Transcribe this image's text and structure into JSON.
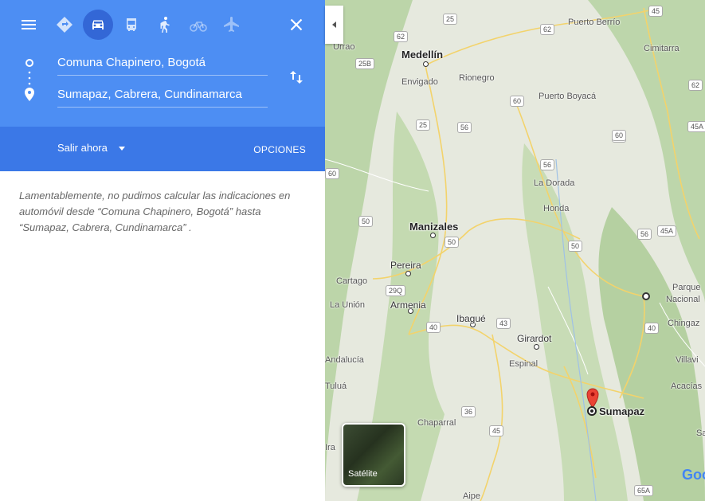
{
  "directions": {
    "origin": "Comuna Chapinero, Bogotá",
    "destination": "Sumapaz, Cabrera, Cundinamarca",
    "depart_label": "Salir ahora",
    "options_label": "OPCIONES",
    "error_message": "Lamentablemente, no pudimos calcular las indicaciones en automóvil desde “Comuna Chapinero, Bogotá” hasta “Sumapaz, Cabrera, Cundinamarca” ."
  },
  "travel_modes": [
    {
      "icon": "best-route-icon",
      "active": false
    },
    {
      "icon": "car-icon",
      "active": true
    },
    {
      "icon": "transit-icon",
      "active": false
    },
    {
      "icon": "walk-icon",
      "active": false
    },
    {
      "icon": "bicycle-icon",
      "active": false
    },
    {
      "icon": "flight-icon",
      "active": false
    }
  ],
  "map": {
    "cities": [
      "Medellín",
      "Manizales",
      "Pereira",
      "Armenia",
      "Ibagué",
      "Girardot",
      "Sumapaz"
    ],
    "towns": [
      "Urrao",
      "Envigado",
      "Rionegro",
      "Puerto Berrío",
      "Cimitarra",
      "Puerto Boyacá",
      "La Dorada",
      "Honda",
      "Cartago",
      "La Unión",
      "Espinal",
      "Chaparral",
      "Tuluá",
      "Andalucía",
      "Aipe",
      "Parque",
      "Nacional",
      "Chingaz",
      "Villavi",
      "Acacías",
      "Ira",
      "Sa"
    ],
    "road_shields": [
      "25",
      "62",
      "25B",
      "45",
      "62",
      "60",
      "25",
      "56",
      "60",
      "56",
      "60",
      "45A",
      "50",
      "50",
      "50",
      "29Q",
      "40",
      "43",
      "40",
      "56",
      "45A",
      "36",
      "45",
      "65A",
      "60",
      "62"
    ],
    "satellite_label": "Satélite",
    "attribution": "Goo"
  },
  "colors": {
    "header_bg": "#4d8ef3",
    "options_bar_bg": "#3b78e7",
    "active_mode_bg": "#3367d6",
    "marker_red": "#ea4335"
  }
}
